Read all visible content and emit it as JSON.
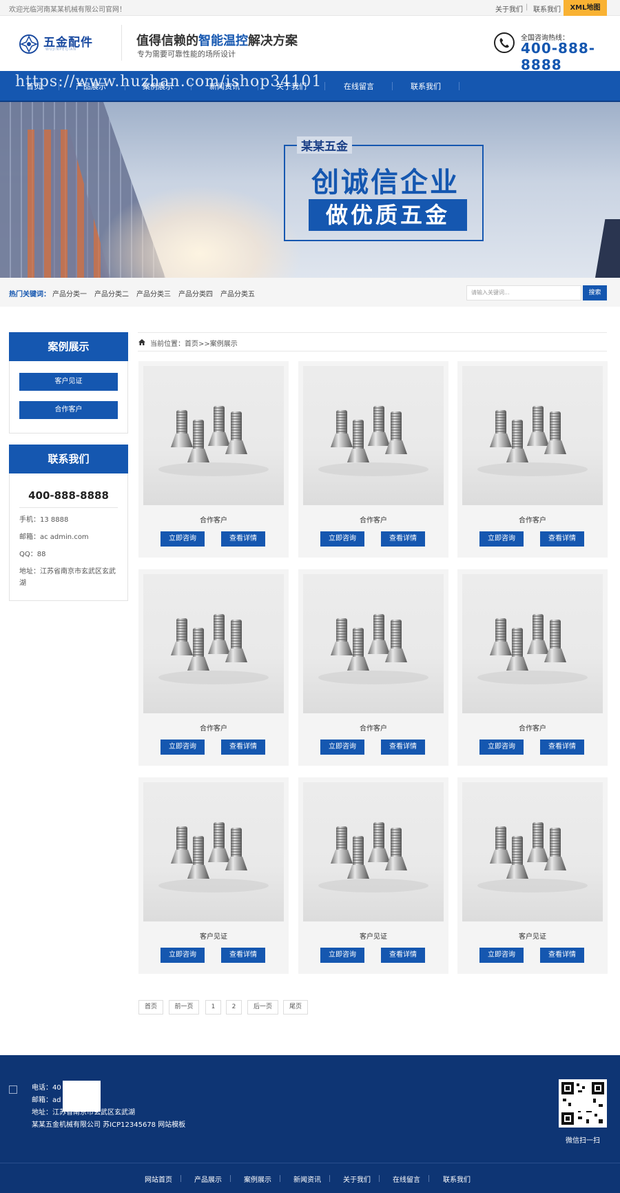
{
  "topbar": {
    "welcome": "欢迎光临河南某某机械有限公司官网！",
    "links": [
      "关于我们",
      "联系我们"
    ],
    "xml": "XML地图"
  },
  "header": {
    "logo_cn": "五金配件",
    "logo_en": "WUJINPEIJIAN",
    "slogan_pre": "值得信赖的",
    "slogan_hl": "智能温控",
    "slogan_post": "解决方案",
    "slogan_sub": "专为需要可靠性能的场所设计",
    "hotline_label": "全国咨询热线：",
    "hotline": "400-888-8888"
  },
  "nav": {
    "items": [
      "首页",
      "产品展示",
      "案例展示",
      "新闻资讯",
      "关于我们",
      "在线留言",
      "联系我们"
    ],
    "watermark": "https://www.huzhan.com/ishop34101"
  },
  "banner": {
    "tag": "某某五金",
    "line1": "创诚信企业",
    "line2": "做优质五金"
  },
  "keywords": {
    "label": "热门关键词：",
    "items": [
      "产品分类一",
      "产品分类二",
      "产品分类三",
      "产品分类四",
      "产品分类五"
    ],
    "search_placeholder": "请输入关键词...",
    "search_button": "搜索"
  },
  "sidebar": {
    "cases_title": "案例展示",
    "cases_items": [
      "客户见证",
      "合作客户"
    ],
    "contact_title": "联系我们",
    "phone": "400-888-8888",
    "mobile": "手机：13    8888",
    "email": "邮箱：ac        admin.com",
    "qq": "QQ：88",
    "address": "地址：江苏省南京市玄武区玄武湖"
  },
  "breadcrumb": "当前位置：首页>>案例展示",
  "cards": [
    {
      "title": "合作客户"
    },
    {
      "title": "合作客户"
    },
    {
      "title": "合作客户"
    },
    {
      "title": "合作客户"
    },
    {
      "title": "合作客户"
    },
    {
      "title": "合作客户"
    },
    {
      "title": "客户见证"
    },
    {
      "title": "客户见证"
    },
    {
      "title": "客户见证"
    }
  ],
  "card_buttons": {
    "consult": "立即咨询",
    "detail": "查看详情"
  },
  "pagination": [
    "首页",
    "前一页",
    "1",
    "2",
    "后一页",
    "尾页"
  ],
  "footer": {
    "phone": "电话：40",
    "email": "邮箱：ad              a.com",
    "address": "地址：江苏省南京市玄武区玄武湖",
    "copyright": "某某五金机械有限公司 苏ICP12345678 网站模板",
    "qr_label": "微信扫一扫",
    "nav": [
      "网站首页",
      "产品展示",
      "案例展示",
      "新闻资讯",
      "关于我们",
      "在线留言",
      "联系我们"
    ]
  },
  "colors": {
    "brand": "#1557b0",
    "footer": "#0e3574",
    "xml": "#f9b233"
  }
}
